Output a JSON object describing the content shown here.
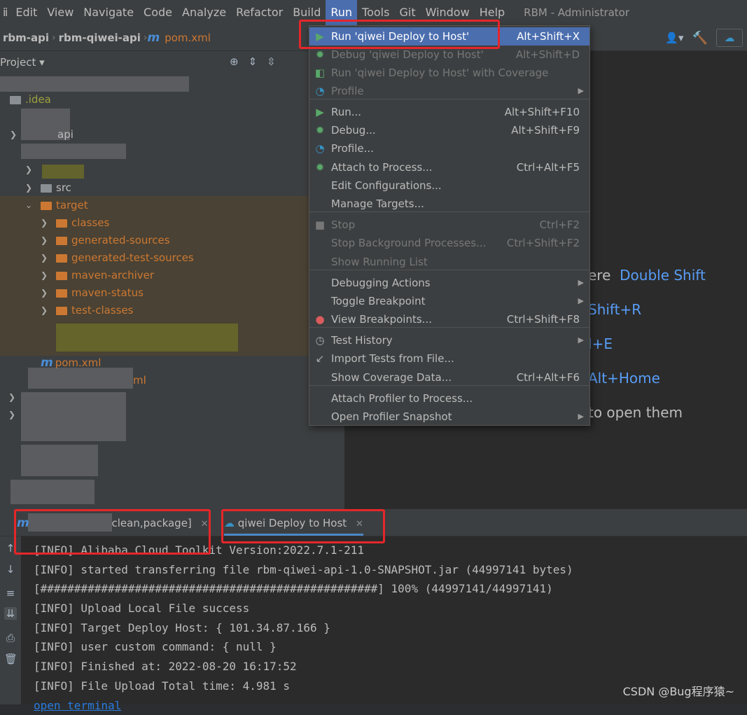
{
  "menubar": {
    "items": [
      "Edit",
      "View",
      "Navigate",
      "Code",
      "Analyze",
      "Refactor",
      "Build",
      "Run",
      "Tools",
      "Git",
      "Window",
      "Help"
    ],
    "active": "Run",
    "window_title": "RBM - Administrator"
  },
  "navbar": {
    "crumbs": [
      "rbm-api",
      "rbm-qiwei-api"
    ],
    "file": "pom.xml"
  },
  "project_panel": {
    "title": "Project",
    "tree": [
      {
        "label": ".idea",
        "style": "idea"
      },
      {
        "label": "api",
        "style": "plain"
      },
      {
        "label": "src",
        "style": "plain"
      },
      {
        "label": "target",
        "style": "orange"
      },
      {
        "label": "classes",
        "style": "orange"
      },
      {
        "label": "generated-sources",
        "style": "orange"
      },
      {
        "label": "generated-test-sources",
        "style": "orange"
      },
      {
        "label": "maven-archiver",
        "style": "orange"
      },
      {
        "label": "maven-status",
        "style": "orange"
      },
      {
        "label": "test-classes",
        "style": "orange"
      },
      {
        "label": "pom.xml",
        "style": "orange"
      },
      {
        "label": "ml",
        "style": "orange"
      }
    ]
  },
  "editor_hints": {
    "h1_text": "ere",
    "h1_key": "Double Shift",
    "h2_key": "Shift+R",
    "h3_key": "l+E",
    "h4_key": "Alt+Home",
    "h5_text": "to open them"
  },
  "run_menu": {
    "items": [
      {
        "label": "Run 'qiwei Deploy  to Host'",
        "shortcut": "Alt+Shift+X",
        "icon": "run-icon",
        "state": "selected"
      },
      {
        "label": "Debug 'qiwei Deploy  to Host'",
        "shortcut": "Alt+Shift+D",
        "icon": "debug-icon",
        "state": "disabled"
      },
      {
        "label": "Run 'qiwei Deploy  to Host' with Coverage",
        "shortcut": "",
        "icon": "coverage-icon",
        "state": "disabled"
      },
      {
        "label": "Profile",
        "shortcut": "",
        "icon": "profile-icon",
        "state": "disabled",
        "submenu": true
      },
      {
        "label": "Run...",
        "shortcut": "Alt+Shift+F10",
        "icon": "run-icon",
        "state": "normal"
      },
      {
        "label": "Debug...",
        "shortcut": "Alt+Shift+F9",
        "icon": "debug-icon",
        "state": "normal"
      },
      {
        "label": "Profile...",
        "shortcut": "",
        "icon": "profile-icon",
        "state": "normal"
      },
      {
        "label": "Attach to Process...",
        "shortcut": "Ctrl+Alt+F5",
        "icon": "attach-icon",
        "state": "normal"
      },
      {
        "label": "Edit Configurations...",
        "shortcut": "",
        "icon": "",
        "state": "normal"
      },
      {
        "label": "Manage Targets...",
        "shortcut": "",
        "icon": "",
        "state": "normal"
      },
      {
        "label": "Stop",
        "shortcut": "Ctrl+F2",
        "icon": "stop-icon",
        "state": "disabled"
      },
      {
        "label": "Stop Background Processes...",
        "shortcut": "Ctrl+Shift+F2",
        "icon": "",
        "state": "disabled"
      },
      {
        "label": "Show Running List",
        "shortcut": "",
        "icon": "",
        "state": "disabled"
      },
      {
        "label": "Debugging Actions",
        "shortcut": "",
        "icon": "",
        "state": "normal",
        "submenu": true
      },
      {
        "label": "Toggle Breakpoint",
        "shortcut": "",
        "icon": "",
        "state": "normal",
        "submenu": true
      },
      {
        "label": "View Breakpoints...",
        "shortcut": "Ctrl+Shift+F8",
        "icon": "breakpoints-icon",
        "state": "normal"
      },
      {
        "label": "Test History",
        "shortcut": "",
        "icon": "history-icon",
        "state": "normal",
        "submenu": true
      },
      {
        "label": "Import Tests from File...",
        "shortcut": "",
        "icon": "import-icon",
        "state": "normal"
      },
      {
        "label": "Show Coverage Data...",
        "shortcut": "Ctrl+Alt+F6",
        "icon": "",
        "state": "normal"
      },
      {
        "label": "Attach Profiler to Process...",
        "shortcut": "",
        "icon": "",
        "state": "normal"
      },
      {
        "label": "Open Profiler Snapshot",
        "shortcut": "",
        "icon": "",
        "state": "normal",
        "submenu": true
      }
    ]
  },
  "run_tabs": [
    {
      "label": "clean,package]",
      "icon": "maven-icon"
    },
    {
      "label": "qiwei Deploy  to Host",
      "icon": "cloud-icon",
      "active": true
    }
  ],
  "console": {
    "lines": [
      "[INFO] Alibaba Cloud Toolkit Version:2022.7.1-211",
      "[INFO] started transferring file rbm-qiwei-api-1.0-SNAPSHOT.jar (44997141 bytes)",
      "[##################################################] 100% (44997141/44997141)",
      "[INFO] Upload Local File success",
      "[INFO] Target Deploy Host: { 101.34.87.166 }",
      "[INFO] user custom command: { null }",
      "[INFO] Finished at: 2022-08-20 16:17:52",
      "[INFO] File Upload Total time: 4.981 s"
    ],
    "link": "open terminal"
  },
  "watermark": "CSDN @Bug程序猿~",
  "colors": {
    "accent": "#4b6eaf",
    "highlight_box": "#e5262a",
    "orange": "#cc7832",
    "link": "#589df6"
  }
}
